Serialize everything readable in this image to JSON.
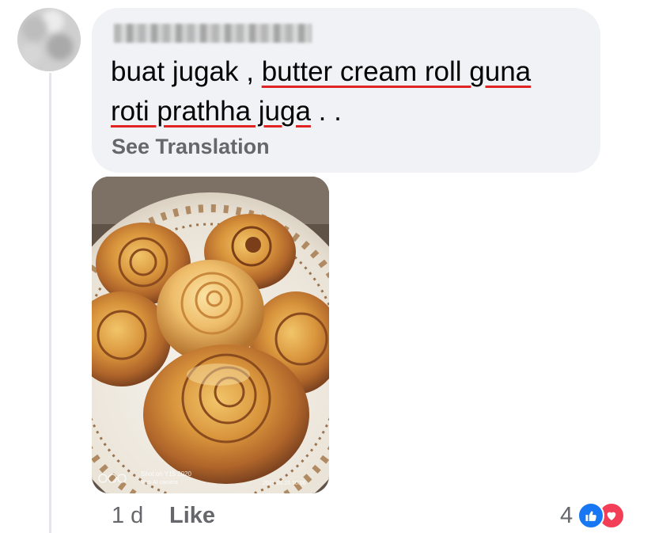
{
  "comment": {
    "text_plain": "buat jugak , ",
    "text_line1_underlined": "butter cream roll guna",
    "text_line2_underlined": "roti prathha juga",
    "text_end": " . .",
    "see_translation": "See Translation"
  },
  "photo": {
    "watermark_line1": "Shot on Y15 2020",
    "watermark_line2": "Vivo AI camera",
    "watermark_date": "2021.06.15 10:06"
  },
  "footer": {
    "timestamp": "1 d",
    "like_label": "Like",
    "reaction_count": "4",
    "reaction_icons": [
      "like-icon",
      "love-icon"
    ]
  },
  "colors": {
    "bubble_bg": "#f0f2f5",
    "secondary_text": "#65676b",
    "like_blue": "#1877f2",
    "love_red": "#f33e58",
    "spellcheck_underline": "#e02424"
  }
}
